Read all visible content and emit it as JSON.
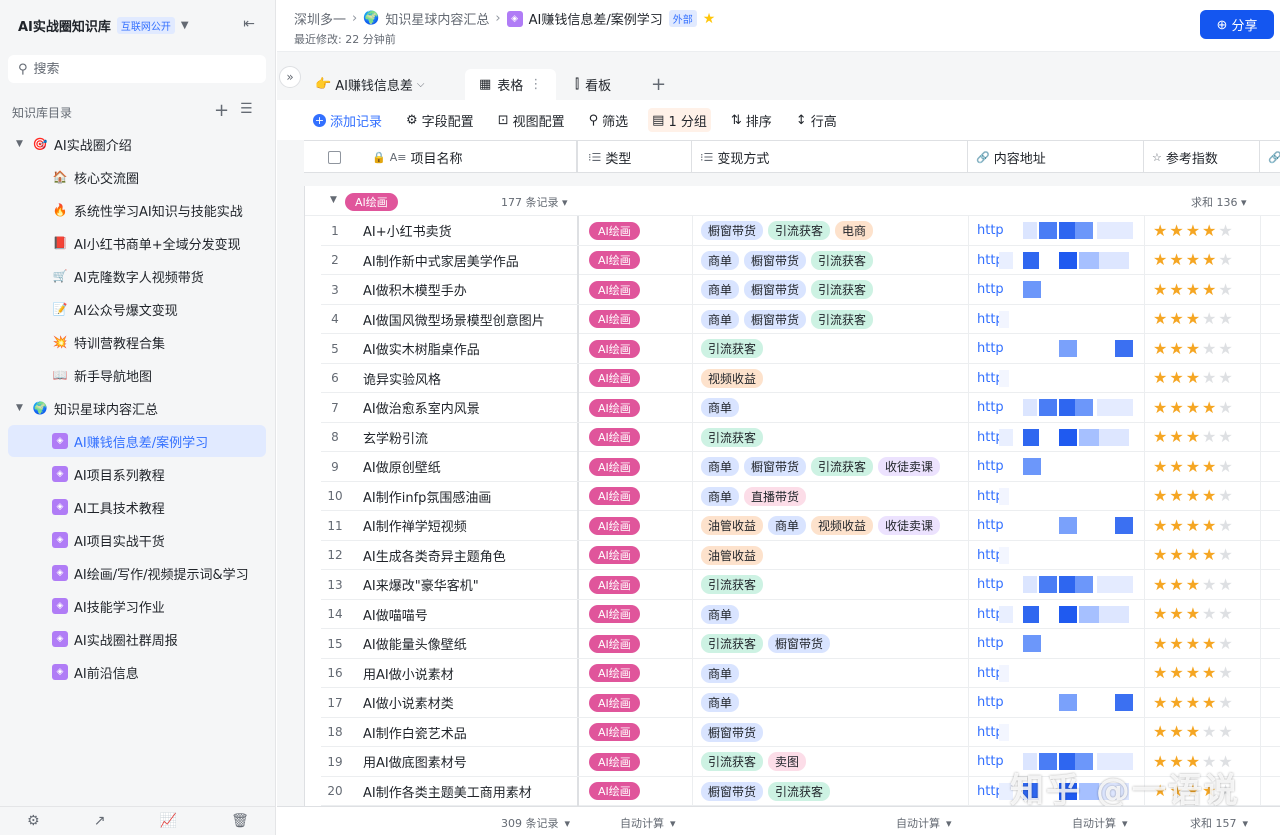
{
  "sidebar": {
    "kb_title": "AI实战圈知识库",
    "kb_badge": "互联网公开",
    "search_placeholder": "搜索",
    "dir_label": "知识库目录",
    "items": [
      {
        "label": "AI实战圈介绍",
        "icon": "target-icon",
        "glyph": "🎯",
        "level": 0,
        "expanded": true
      },
      {
        "label": "核心交流圈",
        "icon": "house-icon",
        "glyph": "🏠",
        "level": 1
      },
      {
        "label": "系统性学习AI知识与技能实战",
        "icon": "fire-icon",
        "glyph": "🔥",
        "level": 1
      },
      {
        "label": "AI小红书商单+全域分发变现",
        "icon": "book-icon",
        "glyph": "📕",
        "level": 1
      },
      {
        "label": "AI克隆数字人视频带货",
        "icon": "cart-icon",
        "glyph": "🛒",
        "level": 1
      },
      {
        "label": "AI公众号爆文变现",
        "icon": "memo-icon",
        "glyph": "📝",
        "level": 1
      },
      {
        "label": "特训营教程合集",
        "icon": "burst-icon",
        "glyph": "💥",
        "level": 1
      },
      {
        "label": "新手导航地图",
        "icon": "open-book-icon",
        "glyph": "📖",
        "level": 1
      },
      {
        "label": "知识星球内容汇总",
        "icon": "globe-icon",
        "glyph": "🌍",
        "level": 0,
        "expanded": true
      },
      {
        "label": "AI赚钱信息差/案例学习",
        "icon": "doc-purple-icon",
        "glyph": "◈",
        "level": 1,
        "active": true
      },
      {
        "label": "AI项目系列教程",
        "icon": "doc-purple-icon",
        "glyph": "◈",
        "level": 1
      },
      {
        "label": "AI工具技术教程",
        "icon": "doc-purple-icon",
        "glyph": "◈",
        "level": 1
      },
      {
        "label": "AI项目实战干货",
        "icon": "doc-purple-icon",
        "glyph": "◈",
        "level": 1
      },
      {
        "label": "AI绘画/写作/视频提示词&学习",
        "icon": "doc-purple-icon",
        "glyph": "◈",
        "level": 1
      },
      {
        "label": "AI技能学习作业",
        "icon": "doc-purple-icon",
        "glyph": "◈",
        "level": 1
      },
      {
        "label": "AI实战圈社群周报",
        "icon": "doc-purple-icon",
        "glyph": "◈",
        "level": 1
      },
      {
        "label": "AI前沿信息",
        "icon": "doc-purple-icon",
        "glyph": "◈",
        "level": 1
      }
    ]
  },
  "header": {
    "breadcrumb": [
      "深圳多一",
      "知识星球内容汇总",
      "AI赚钱信息差/案例学习"
    ],
    "ext_badge": "外部",
    "modified": "最近修改: 22 分钟前",
    "share_label": "分享"
  },
  "views": {
    "table_name": "AI赚钱信息差",
    "tabs": [
      {
        "label": "表格",
        "icon": "grid-icon"
      },
      {
        "label": "看板",
        "icon": "kanban-icon"
      }
    ]
  },
  "toolbar": {
    "add_record": "添加记录",
    "field_config": "字段配置",
    "view_config": "视图配置",
    "filter": "筛选",
    "group": "1 分组",
    "sort": "排序",
    "row_height": "行高"
  },
  "columns": [
    {
      "label": "项目名称",
      "type": "text"
    },
    {
      "label": "类型",
      "type": "select"
    },
    {
      "label": "变现方式",
      "type": "multiselect"
    },
    {
      "label": "内容地址",
      "type": "link"
    },
    {
      "label": "参考指数",
      "type": "rating"
    }
  ],
  "group": {
    "name": "AI绘画",
    "count": "177 条记录",
    "sum": "求和 136"
  },
  "tag_colors": {
    "橱窗带货": "t-blue",
    "商单": "t-blue",
    "引流获客": "t-green",
    "电商": "t-orange",
    "视频收益": "t-orange",
    "油管收益": "t-orange",
    "直播带货": "t-pink",
    "卖图": "t-pink",
    "收徒卖课": "t-purple"
  },
  "rows": [
    {
      "n": "1",
      "name": "AI+小红书卖货",
      "type": "AI绘画",
      "methods": [
        "橱窗带货",
        "引流获客",
        "电商"
      ],
      "url": "http",
      "rating": 4
    },
    {
      "n": "2",
      "name": "AI制作新中式家居美学作品",
      "type": "AI绘画",
      "methods": [
        "商单",
        "橱窗带货",
        "引流获客"
      ],
      "url": "http",
      "rating": 4
    },
    {
      "n": "3",
      "name": "AI做积木模型手办",
      "type": "AI绘画",
      "methods": [
        "商单",
        "橱窗带货",
        "引流获客"
      ],
      "url": "http",
      "rating": 4
    },
    {
      "n": "4",
      "name": "AI做国风微型场景模型创意图片",
      "type": "AI绘画",
      "methods": [
        "商单",
        "橱窗带货",
        "引流获客"
      ],
      "url": "http",
      "rating": 3
    },
    {
      "n": "5",
      "name": "AI做实木树脂桌作品",
      "type": "AI绘画",
      "methods": [
        "引流获客"
      ],
      "url": "http",
      "rating": 3
    },
    {
      "n": "6",
      "name": "诡异实验风格",
      "type": "AI绘画",
      "methods": [
        "视频收益"
      ],
      "url": "http",
      "rating": 3
    },
    {
      "n": "7",
      "name": "AI做治愈系室内风景",
      "type": "AI绘画",
      "methods": [
        "商单"
      ],
      "url": "http",
      "rating": 4
    },
    {
      "n": "8",
      "name": "玄学粉引流",
      "type": "AI绘画",
      "methods": [
        "引流获客"
      ],
      "url": "http",
      "rating": 3
    },
    {
      "n": "9",
      "name": "AI做原创壁纸",
      "type": "AI绘画",
      "methods": [
        "商单",
        "橱窗带货",
        "引流获客",
        "收徒卖课"
      ],
      "url": "http",
      "rating": 4
    },
    {
      "n": "10",
      "name": "AI制作infp氛围感油画",
      "type": "AI绘画",
      "methods": [
        "商单",
        "直播带货"
      ],
      "url": "http",
      "rating": 4
    },
    {
      "n": "11",
      "name": "AI制作禅学短视频",
      "type": "AI绘画",
      "methods": [
        "油管收益",
        "商单",
        "视频收益",
        "收徒卖课"
      ],
      "url": "http",
      "rating": 4
    },
    {
      "n": "12",
      "name": "AI生成各类奇异主题角色",
      "type": "AI绘画",
      "methods": [
        "油管收益"
      ],
      "url": "http",
      "rating": 4
    },
    {
      "n": "13",
      "name": "AI来爆改\"豪华客机\"",
      "type": "AI绘画",
      "methods": [
        "引流获客"
      ],
      "url": "http",
      "rating": 3
    },
    {
      "n": "14",
      "name": "AI做喵喵号",
      "type": "AI绘画",
      "methods": [
        "商单"
      ],
      "url": "http",
      "rating": 3
    },
    {
      "n": "15",
      "name": "AI做能量头像壁纸",
      "type": "AI绘画",
      "methods": [
        "引流获客",
        "橱窗带货"
      ],
      "url": "http",
      "rating": 4
    },
    {
      "n": "16",
      "name": "用AI做小说素材",
      "type": "AI绘画",
      "methods": [
        "商单"
      ],
      "url": "http",
      "rating": 4
    },
    {
      "n": "17",
      "name": "AI做小说素材类",
      "type": "AI绘画",
      "methods": [
        "商单"
      ],
      "url": "http",
      "rating": 4
    },
    {
      "n": "18",
      "name": "AI制作白瓷艺术品",
      "type": "AI绘画",
      "methods": [
        "橱窗带货"
      ],
      "url": "http",
      "rating": 3
    },
    {
      "n": "19",
      "name": "用AI做底图素材号",
      "type": "AI绘画",
      "methods": [
        "引流获客",
        "卖图"
      ],
      "url": "http",
      "rating": 3
    },
    {
      "n": "20",
      "name": "AI制作各类主题美工商用素材",
      "type": "AI绘画",
      "methods": [
        "橱窗带货",
        "引流获客"
      ],
      "url": "http",
      "rating": 4
    }
  ],
  "footer": {
    "records": "309 条记录",
    "auto1": "自动计算",
    "auto2": "自动计算",
    "auto3": "自动计算",
    "sum": "求和 157"
  },
  "watermark": "知乎 @一语说"
}
